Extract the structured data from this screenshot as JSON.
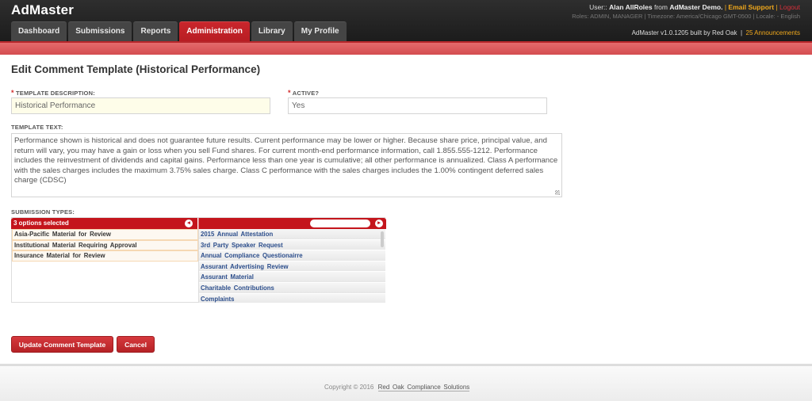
{
  "app": {
    "title": "AdMaster"
  },
  "nav": {
    "tabs": [
      {
        "label": "Dashboard",
        "active": false
      },
      {
        "label": "Submissions",
        "active": false
      },
      {
        "label": "Reports",
        "active": false
      },
      {
        "label": "Administration",
        "active": true
      },
      {
        "label": "Library",
        "active": false
      },
      {
        "label": "My Profile",
        "active": false
      }
    ]
  },
  "user": {
    "prefix": "User::",
    "name": "Alan AllRoles",
    "from": "from",
    "org": "AdMaster Demo.",
    "email_support": "Email Support",
    "logout": "Logout",
    "roles_line": "Roles: ADMIN, MANAGER | Timezone: America/Chicago GMT-0500 | Locale: - English",
    "version": "AdMaster v1.0.1205 built by Red Oak",
    "announcements": "25 Announcements"
  },
  "page": {
    "title": "Edit Comment Template (Historical Performance)"
  },
  "form": {
    "description_label": "TEMPLATE DESCRIPTION:",
    "description_value": "Historical Performance",
    "active_label": "ACTIVE?",
    "active_value": "Yes",
    "text_label": "TEMPLATE TEXT:",
    "text_value": "Performance shown is historical and does not guarantee future results. Current performance may be lower or higher. Because share price, principal value, and return will vary, you may have a gain or loss when you sell Fund shares. For current month-end performance information, call 1.855.555-1212. Performance includes the reinvestment of dividends and capital gains. Performance less than one year is cumulative; all other performance is annualized. Class A performance with the sales charges includes the maximum 3.75% sales charge. Class C performance with the sales charges includes the 1.00% contingent deferred sales charge (CDSC)",
    "required_mark": "*",
    "submission_types_label": "SUBMISSION TYPES:"
  },
  "multiselect": {
    "selected_count": "3 options selected",
    "remove_all_icon": "◂",
    "add_all_icon": "▸",
    "search_value": "",
    "selected": [
      "Asia-Pacific Material for Review",
      "Institutional Material Requiring Approval",
      "Insurance Material for Review"
    ],
    "available": [
      "2015 Annual Attestation",
      "3rd Party Speaker Request",
      "Annual Compliance Questionairre",
      "Assurant Advertising Review",
      "Assurant Material",
      "Charitable Contributions",
      "Complaints"
    ]
  },
  "buttons": {
    "update": "Update Comment Template",
    "cancel": "Cancel"
  },
  "footer": {
    "copyright": "Copyright © 2016",
    "company": "Red Oak Compliance Solutions"
  }
}
